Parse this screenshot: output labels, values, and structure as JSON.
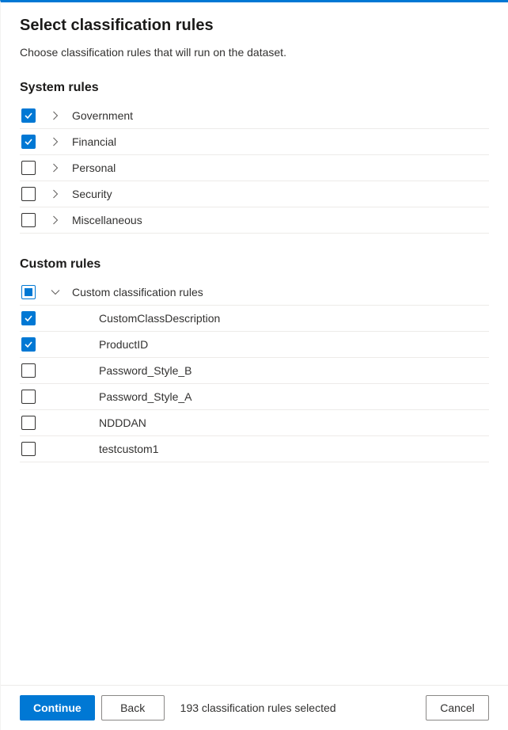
{
  "title": "Select classification rules",
  "description": "Choose classification rules that will run on the dataset.",
  "sections": {
    "system": {
      "header": "System rules",
      "items": [
        {
          "label": "Government",
          "checked": true,
          "expandable": true,
          "expanded": false
        },
        {
          "label": "Financial",
          "checked": true,
          "expandable": true,
          "expanded": false
        },
        {
          "label": "Personal",
          "checked": false,
          "expandable": true,
          "expanded": false
        },
        {
          "label": "Security",
          "checked": false,
          "expandable": true,
          "expanded": false
        },
        {
          "label": "Miscellaneous",
          "checked": false,
          "expandable": true,
          "expanded": false
        }
      ]
    },
    "custom": {
      "header": "Custom rules",
      "group": {
        "label": "Custom classification rules",
        "state": "indeterminate",
        "expanded": true
      },
      "items": [
        {
          "label": "CustomClassDescription",
          "checked": true
        },
        {
          "label": "ProductID",
          "checked": true
        },
        {
          "label": "Password_Style_B",
          "checked": false
        },
        {
          "label": "Password_Style_A",
          "checked": false
        },
        {
          "label": "NDDDAN",
          "checked": false
        },
        {
          "label": "testcustom1",
          "checked": false
        }
      ]
    }
  },
  "footer": {
    "continue": "Continue",
    "back": "Back",
    "cancel": "Cancel",
    "status": "193 classification rules selected"
  }
}
